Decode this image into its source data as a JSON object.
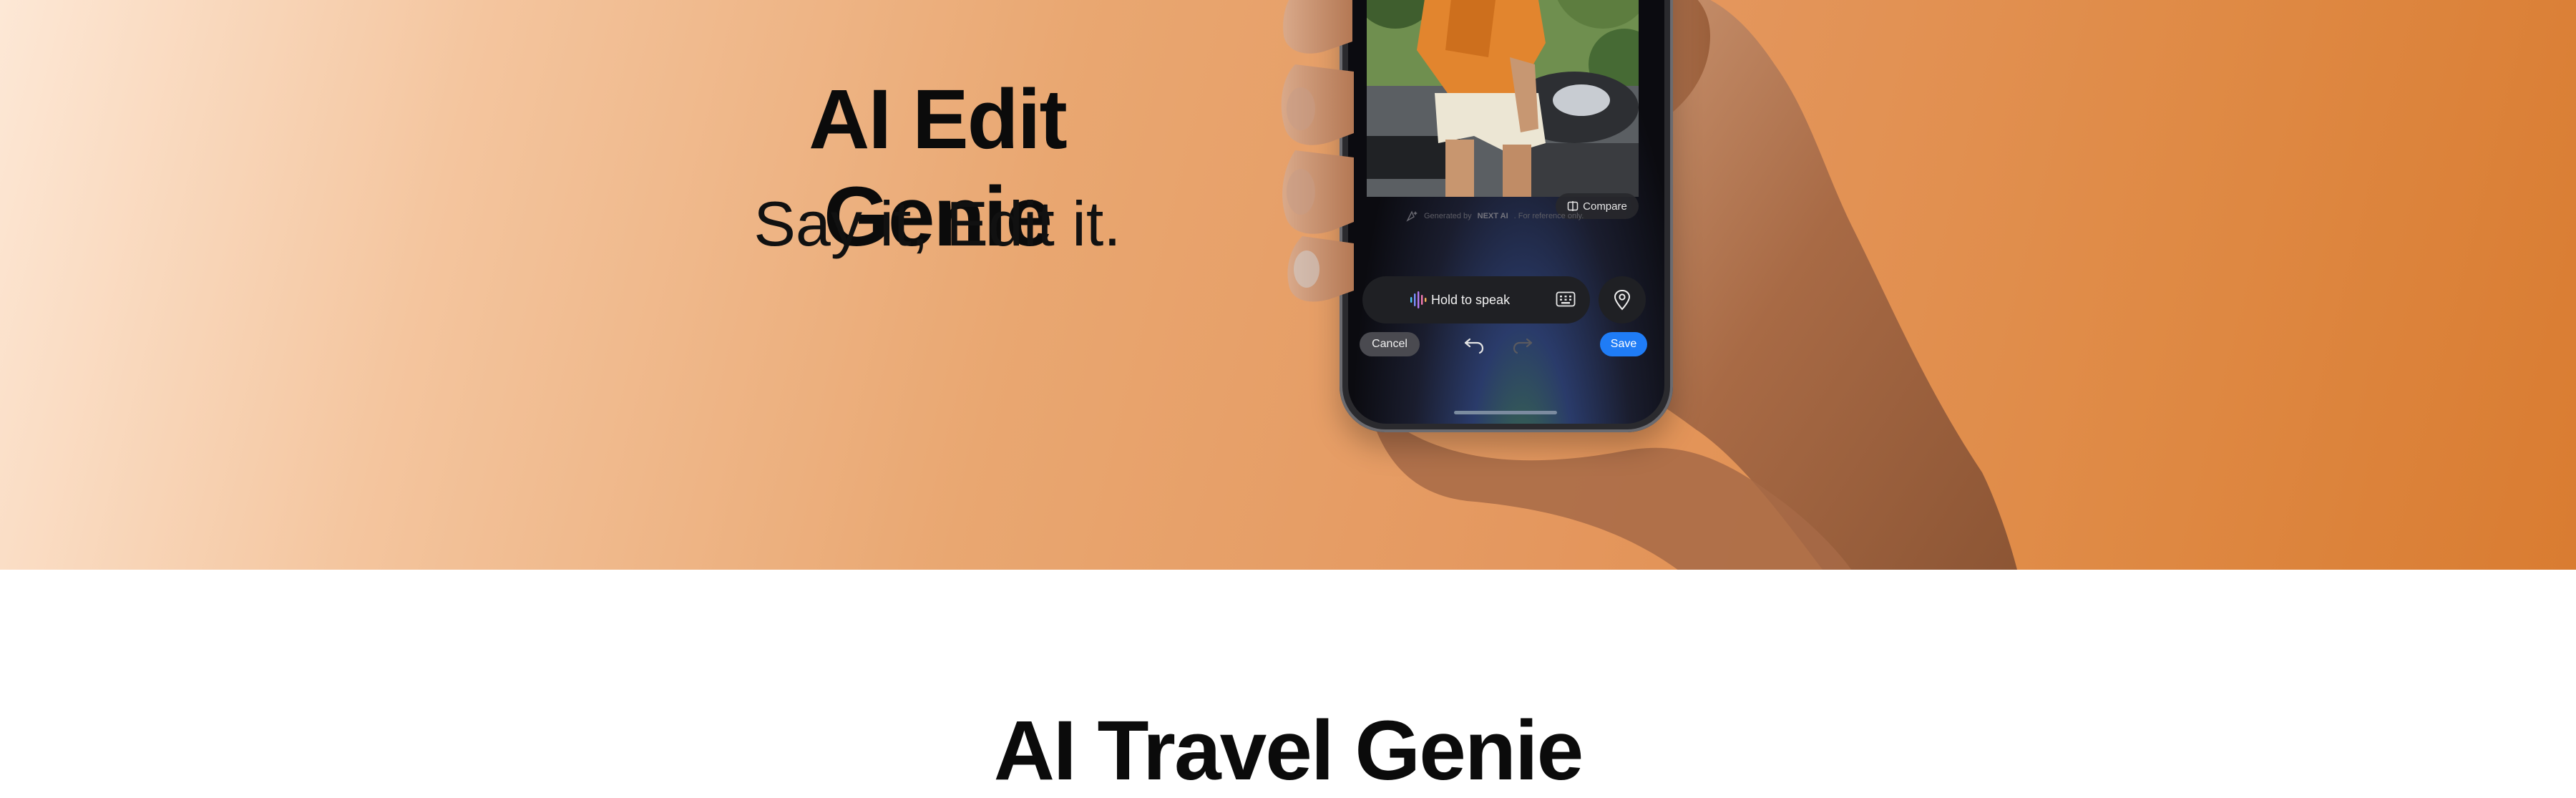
{
  "hero": {
    "title": "AI Edit Genie",
    "subtitle": "Say it, Edit it.",
    "background_colors": [
      "#fde8d6",
      "#e9a771",
      "#d97c31"
    ]
  },
  "phone_screen": {
    "compare_label": "Compare",
    "generated_prefix": "Generated by",
    "generated_brand": "NEXT AI",
    "generated_suffix": ". For reference only.",
    "speak_label": "Hold to speak",
    "cancel_label": "Cancel",
    "save_label": "Save",
    "accent_color": "#1f7cf6"
  },
  "next_section": {
    "title": "AI Travel Genie"
  }
}
